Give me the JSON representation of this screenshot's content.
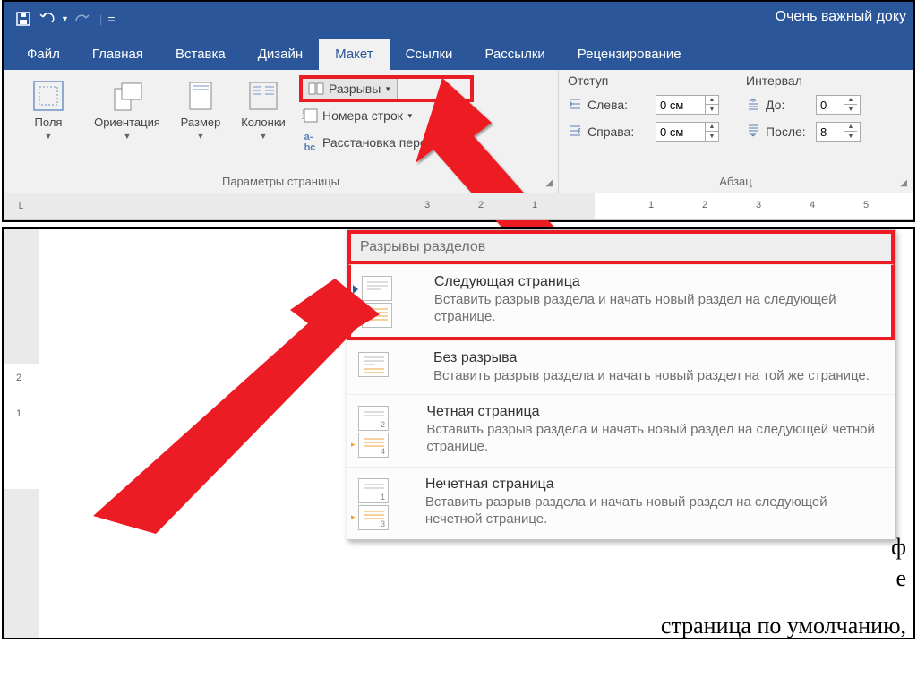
{
  "title": "Очень важный доку",
  "tabs": {
    "file": "Файл",
    "home": "Главная",
    "insert": "Вставка",
    "design": "Дизайн",
    "layout": "Макет",
    "references": "Ссылки",
    "mailings": "Рассылки",
    "review": "Рецензирование"
  },
  "page_setup": {
    "margins": "Поля",
    "orientation": "Ориентация",
    "size": "Размер",
    "columns": "Колонки",
    "breaks": "Разрывы",
    "line_numbers": "Номера строк",
    "hyphenation": "Расстановка переносов",
    "caption": "Параметры страницы"
  },
  "paragraph": {
    "indent_label": "Отступ",
    "left": "Слева:",
    "right": "Справа:",
    "left_val": "0 см",
    "right_val": "0 см",
    "spacing_label": "Интервал",
    "before": "До:",
    "after": "После:",
    "before_val": "0",
    "after_val": "8",
    "caption": "Абзац"
  },
  "dropdown": {
    "header": "Разрывы разделов",
    "items": [
      {
        "title": "Следующая страница",
        "desc": "Вставить разрыв раздела и начать новый раздел на следующей странице."
      },
      {
        "title": "Без разрыва",
        "desc": "Вставить разрыв раздела и начать новый раздел на той же странице."
      },
      {
        "title": "Четная страница",
        "desc": "Вставить разрыв раздела и начать новый раздел на следующей четной странице."
      },
      {
        "title": "Нечетная страница",
        "desc": "Вставить разрыв раздела и начать новый раздел на следующей нечетной странице."
      }
    ]
  },
  "page_text": "страница по умолчанию,",
  "ruler_l": "L",
  "thumbs": {
    "n2": "2",
    "n4": "4",
    "n1": "1",
    "n3": "3"
  }
}
